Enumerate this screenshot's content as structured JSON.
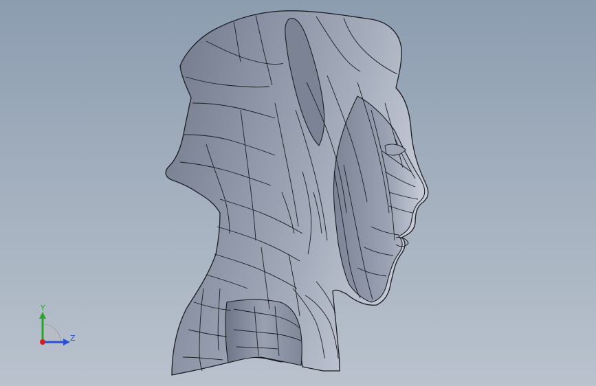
{
  "viewport": {
    "background_top": "#8c9db0",
    "background_bottom": "#b9c2cd",
    "model": {
      "shade_color": "#7d8597",
      "highlight_color": "#c2c8d5",
      "edge_color": "#1a1c22"
    },
    "triad": {
      "y_label": "Y",
      "z_label": "Z",
      "y_color": "#2aa52a",
      "z_color": "#2a4fd6",
      "origin_color": "#d02020"
    }
  }
}
